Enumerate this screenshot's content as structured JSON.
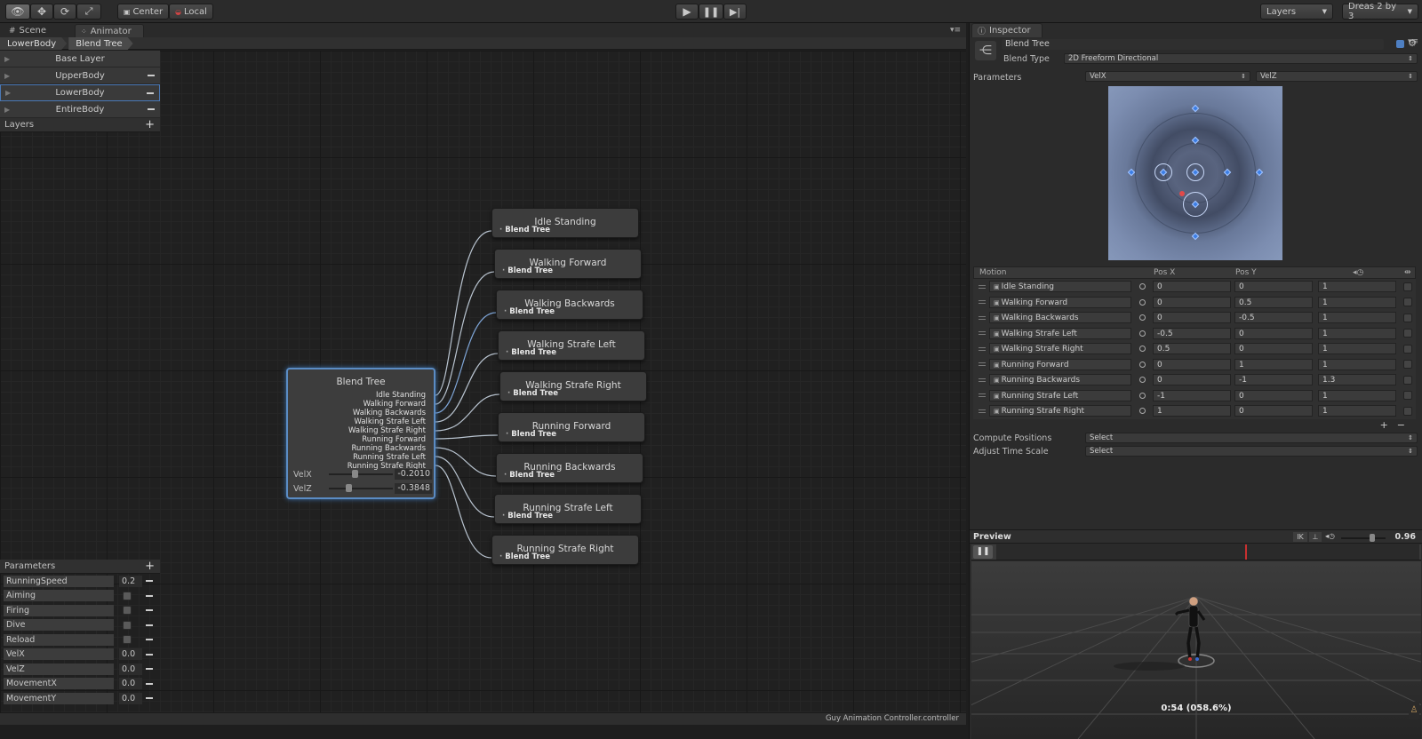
{
  "toolbar": {
    "pivot_label": "Center",
    "space_label": "Local",
    "layers_label": "Layers",
    "layout_label": "Dreas 2 by 3"
  },
  "tabs": [
    {
      "label": "Scene"
    },
    {
      "label": "Animator"
    }
  ],
  "breadcrumbs": [
    "LowerBody",
    "Blend Tree"
  ],
  "layers": {
    "items": [
      {
        "label": "Base Layer"
      },
      {
        "label": "UpperBody"
      },
      {
        "label": "LowerBody"
      },
      {
        "label": "EntireBody"
      }
    ],
    "header": "Layers"
  },
  "parameters": {
    "header": "Parameters",
    "items": [
      {
        "name": "RunningSpeed",
        "value": "0.2"
      },
      {
        "name": "Aiming",
        "value": null,
        "type": "bool"
      },
      {
        "name": "Firing",
        "value": null,
        "type": "bool"
      },
      {
        "name": "Dive",
        "value": null,
        "type": "bool"
      },
      {
        "name": "Reload",
        "value": null,
        "type": "bool"
      },
      {
        "name": "VelX",
        "value": "0.0"
      },
      {
        "name": "VelZ",
        "value": "0.0"
      },
      {
        "name": "MovementX",
        "value": "0.0"
      },
      {
        "name": "MovementY",
        "value": "0.0"
      }
    ]
  },
  "blend_tree_node": {
    "title": "Blend Tree",
    "outputs": [
      "Idle Standing",
      "Walking Forward",
      "Walking Backwards",
      "Walking Strafe Left",
      "Walking Strafe Right",
      "Running Forward",
      "Running Backwards",
      "Running Strafe Left",
      "Running Strafe Right"
    ],
    "velx_label": "VelX",
    "velx_value": "-0.2010",
    "velx_fraction": 0.4,
    "velz_label": "VelZ",
    "velz_value": "-0.3848",
    "velz_fraction": 0.31
  },
  "motion_nodes": [
    {
      "title": "Idle Standing",
      "sub": "Blend Tree"
    },
    {
      "title": "Walking Forward",
      "sub": "Blend Tree"
    },
    {
      "title": "Walking Backwards",
      "sub": "Blend Tree"
    },
    {
      "title": "Walking Strafe Left",
      "sub": "Blend Tree"
    },
    {
      "title": "Walking Strafe Right",
      "sub": "Blend Tree"
    },
    {
      "title": "Running Forward",
      "sub": "Blend Tree"
    },
    {
      "title": "Running Backwards",
      "sub": "Blend Tree"
    },
    {
      "title": "Running Strafe Left",
      "sub": "Blend Tree"
    },
    {
      "title": "Running Strafe Right",
      "sub": "Blend Tree"
    }
  ],
  "graph_status": "Guy Animation Controller.controller",
  "inspector": {
    "tab_label": "Inspector",
    "name": "Blend Tree",
    "blend_type_label": "Blend Type",
    "blend_type_value": "2D Freeform Directional",
    "parameters_label": "Parameters",
    "param_x": "VelX",
    "param_y": "VelZ",
    "table_headers": {
      "motion": "Motion",
      "pos_x": "Pos X",
      "pos_y": "Pos Y"
    },
    "motions": [
      {
        "name": "Idle Standing",
        "x": "0",
        "y": "0",
        "speed": "1"
      },
      {
        "name": "Walking Forward",
        "x": "0",
        "y": "0.5",
        "speed": "1"
      },
      {
        "name": "Walking Backwards",
        "x": "0",
        "y": "-0.5",
        "speed": "1"
      },
      {
        "name": "Walking Strafe Left",
        "x": "-0.5",
        "y": "0",
        "speed": "1"
      },
      {
        "name": "Walking Strafe Right",
        "x": "0.5",
        "y": "0",
        "speed": "1"
      },
      {
        "name": "Running Forward",
        "x": "0",
        "y": "1",
        "speed": "1"
      },
      {
        "name": "Running Backwards",
        "x": "0",
        "y": "-1",
        "speed": "1.3"
      },
      {
        "name": "Running Strafe Left",
        "x": "-1",
        "y": "0",
        "speed": "1"
      },
      {
        "name": "Running Strafe Right",
        "x": "1",
        "y": "0",
        "speed": "1"
      }
    ],
    "compute_positions_label": "Compute Positions",
    "compute_positions_value": "Select",
    "adjust_time_scale_label": "Adjust Time Scale",
    "adjust_time_scale_value": "Select",
    "preview_label": "Preview",
    "preview_ik": "IK",
    "preview_speed": "0.96",
    "preview_time": "0:54 (058.6%)"
  },
  "colors": {
    "accent": "#5b8cc4",
    "panel": "#383838",
    "background": "#202020"
  }
}
